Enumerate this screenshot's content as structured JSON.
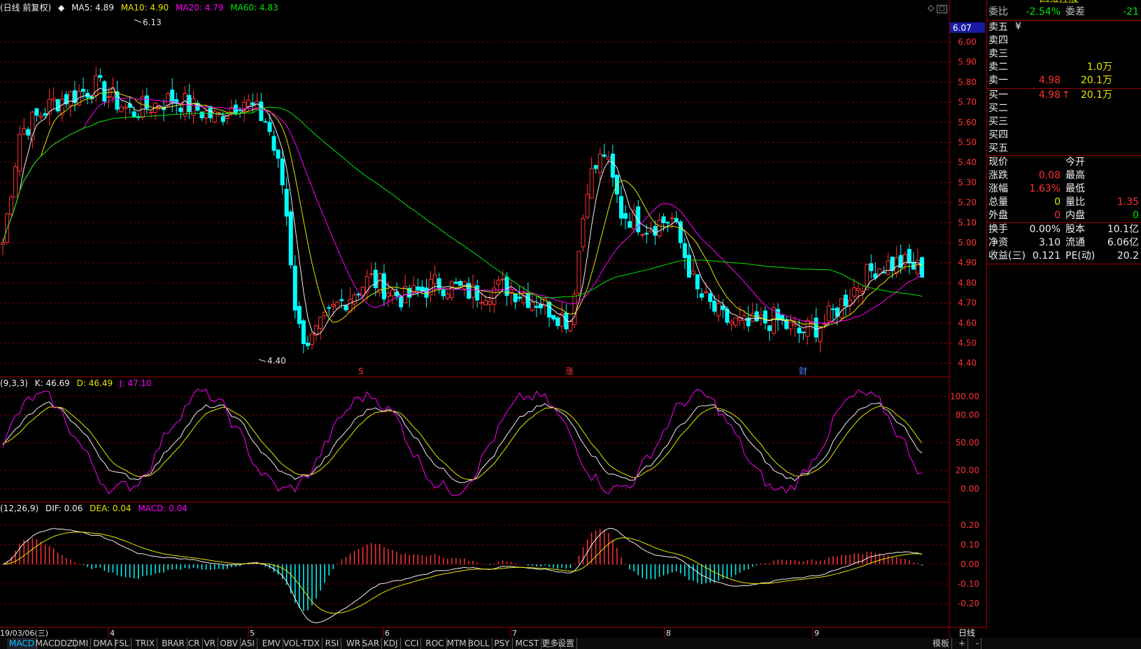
{
  "header_main": {
    "title": "(日线 前复权)",
    "ma5": "MA5: 4.89",
    "ma10": "MA10: 4.90",
    "ma20": "MA20: 4.79",
    "ma60": "MA60: 4.83"
  },
  "header_kdj": {
    "title": "(9,3,3)",
    "k": "K: 46.69",
    "d": "D: 46.49",
    "j": "J: 47.10"
  },
  "header_macd": {
    "title": "(12,26,9)",
    "dif": "DIF: 0.06",
    "dea": "DEA: 0.04",
    "macd": "MACD: 0.04"
  },
  "price_axis": {
    "labels": [
      "6.00",
      "5.90",
      "5.80",
      "5.70",
      "5.60",
      "5.50",
      "5.40",
      "5.30",
      "5.20",
      "5.10",
      "5.00",
      "4.90",
      "4.80",
      "4.70",
      "4.60",
      "4.50",
      "4.40"
    ],
    "values": [
      6.0,
      5.9,
      5.8,
      5.7,
      5.6,
      5.5,
      5.4,
      5.3,
      5.2,
      5.1,
      5.0,
      4.9,
      4.8,
      4.7,
      4.6,
      4.5,
      4.4
    ],
    "highlight_label": "6.07",
    "highlight_value": 6.07
  },
  "kdj_axis": {
    "labels": [
      "100.00",
      "80.00",
      "50.00",
      "20.00",
      "0.00"
    ],
    "values": [
      100,
      80,
      50,
      20,
      0
    ]
  },
  "macd_axis": {
    "labels": [
      "0.20",
      "0.10",
      "0.00",
      "-0.10",
      "-0.20"
    ],
    "values": [
      0.2,
      0.1,
      0,
      -0.1,
      -0.2
    ]
  },
  "annotations": {
    "high": "6.13",
    "low": "4.40",
    "event_s": "S",
    "event_zhang": "涨",
    "event_cai": "财"
  },
  "date_axis": {
    "first": "19/03/06(三)",
    "months": [
      "4",
      "5",
      "6",
      "7",
      "8",
      "9"
    ],
    "period": "日线"
  },
  "colors": {
    "up": "#ff3232",
    "down": "#00ffff",
    "ma5": "#f0f0f0",
    "ma10": "#e6e600",
    "ma20": "#ff00ff",
    "ma60": "#00e600",
    "grid": "#a00000"
  },
  "right_panel": {
    "title": "四维控股",
    "weibi_label": "委比",
    "weibi_value": "-2.54%",
    "weicha_label": "委差",
    "weicha_value": "-21",
    "sell": [
      {
        "label": "卖五",
        "price": "",
        "vol": ""
      },
      {
        "label": "卖四",
        "price": "",
        "vol": ""
      },
      {
        "label": "卖三",
        "price": "",
        "vol": ""
      },
      {
        "label": "卖二",
        "price": "",
        "vol": "1.0万"
      },
      {
        "label": "卖一",
        "price": "4.98",
        "vol": "20.1万"
      }
    ],
    "sell_mark": "¥",
    "buy": [
      {
        "label": "买一",
        "price": "4.98",
        "vol": "20.1万"
      },
      {
        "label": "买二",
        "price": "",
        "vol": ""
      },
      {
        "label": "买三",
        "price": "",
        "vol": ""
      },
      {
        "label": "买四",
        "price": "",
        "vol": ""
      },
      {
        "label": "买五",
        "price": "",
        "vol": ""
      }
    ],
    "buy_mark": "↑",
    "stats1": [
      {
        "l1": "现价",
        "v1": "",
        "l2": "今开",
        "v2": ""
      },
      {
        "l1": "涨跌",
        "v1": "0.08",
        "l2": "最高",
        "v2": ""
      },
      {
        "l1": "涨幅",
        "v1": "1.63%",
        "l2": "最低",
        "v2": ""
      },
      {
        "l1": "总量",
        "v1": "0",
        "l2": "量比",
        "v2": "1.35"
      },
      {
        "l1": "外盘",
        "v1": "0",
        "l2": "内盘",
        "v2": "0"
      }
    ],
    "stats2": [
      {
        "l1": "换手",
        "v1": "0.00%",
        "l2": "股本",
        "v2": "10.1亿"
      },
      {
        "l1": "净资",
        "v1": "3.10",
        "l2": "流通",
        "v2": "6.06亿"
      },
      {
        "l1": "收益(三)",
        "v1": "0.121",
        "l2": "PE(动)",
        "v2": "20.2"
      }
    ]
  },
  "tabs": [
    "MACD",
    "MACDDZ",
    "DMI",
    "DMA",
    "FSL",
    "TRIX",
    "BRAR",
    "CR",
    "VR",
    "OBV",
    "ASI",
    "EMV",
    "VOL-TDX",
    "RSI",
    "WR",
    "SAR",
    "KDJ",
    "CCI",
    "ROC",
    "MTM",
    "BOLL",
    "PSY",
    "MCST",
    "更多",
    "设置"
  ],
  "tabs_right": {
    "template": "模板",
    "plus": "+",
    "minus": "-"
  }
}
